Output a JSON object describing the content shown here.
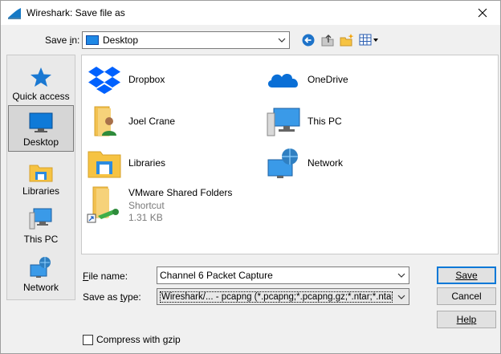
{
  "window": {
    "title": "Wireshark: Save file as"
  },
  "toolbar": {
    "save_in_label": "Save in:",
    "save_in_mnemonic": "i",
    "location": "Desktop"
  },
  "places": [
    {
      "label": "Quick access",
      "icon": "star-icon"
    },
    {
      "label": "Desktop",
      "icon": "desktop-icon"
    },
    {
      "label": "Libraries",
      "icon": "libraries-icon"
    },
    {
      "label": "This PC",
      "icon": "this-pc-icon"
    },
    {
      "label": "Network",
      "icon": "network-icon"
    }
  ],
  "files": [
    {
      "name": "Dropbox",
      "icon": "dropbox-icon"
    },
    {
      "name": "OneDrive",
      "icon": "onedrive-icon"
    },
    {
      "name": "Joel Crane",
      "icon": "user-folder-icon"
    },
    {
      "name": "This PC",
      "icon": "this-pc-icon"
    },
    {
      "name": "Libraries",
      "icon": "libraries-icon"
    },
    {
      "name": "Network",
      "icon": "network-icon"
    },
    {
      "name": "VMware Shared Folders",
      "type": "Shortcut",
      "size": "1.31 KB",
      "icon": "shortcut-folder-icon"
    }
  ],
  "form": {
    "file_name_label": "File name:",
    "file_name_value": "Channel 6 Packet Capture",
    "save_type_label": "Save as type:",
    "save_type_value": "Wireshark/... - pcapng (*.pcapng;*.pcapng.gz;*.ntar;*.ntar.gz)",
    "compress_label": "Compress with gzip",
    "compress_checked": false
  },
  "buttons": {
    "save": "Save",
    "cancel": "Cancel",
    "help": "Help"
  }
}
